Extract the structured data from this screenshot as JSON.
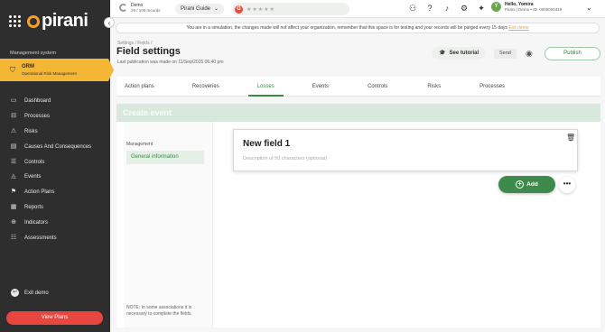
{
  "colors": {
    "brand": "#f4a12c",
    "module": "#f4b735",
    "accent": "#3b8a48",
    "danger": "#e9463f",
    "sidebar": "#2e2e2e"
  },
  "sidebar": {
    "logo": "pirani",
    "section_label": "Management system",
    "module": {
      "title": "ORM",
      "subtitle": "Operational Risk Management",
      "icon": "shield-icon"
    },
    "items": [
      {
        "label": "Dashboard",
        "icon": "monitor-icon"
      },
      {
        "label": "Processes",
        "icon": "processes-icon"
      },
      {
        "label": "Risks",
        "icon": "warning-icon"
      },
      {
        "label": "Causes And Consequences",
        "icon": "document-icon"
      },
      {
        "label": "Controls",
        "icon": "controls-icon"
      },
      {
        "label": "Events",
        "icon": "alert-icon"
      },
      {
        "label": "Action Plans",
        "icon": "flag-icon"
      },
      {
        "label": "Reports",
        "icon": "reports-icon"
      },
      {
        "label": "Indicators",
        "icon": "indicators-icon"
      },
      {
        "label": "Assessments",
        "icon": "assessments-icon"
      }
    ],
    "exit_label": "Exit demo",
    "view_plans_label": "View Plans"
  },
  "topbar": {
    "env_title": "Demo",
    "env_records": "29 / 100 records",
    "guide_label": "Pirani Guide",
    "user_greeting": "Hello, Yomira",
    "user_detail": "Pirani | Demo • ID: 0000000419",
    "avatar_initial": "Y"
  },
  "banner": {
    "text": "You are in a simulation, the changes made will not affect your organization, remember that this space is for testing and your records will be purged every 15 days",
    "link": "Exit demo"
  },
  "header": {
    "breadcrumb": "Settings / Fields /",
    "title": "Field settings",
    "last_publication": "Last publication was made on 11/Sep/2025 06:40 pm",
    "tutorial_label": "See tutorial",
    "send_label": "Send",
    "publish_label": "Publish"
  },
  "tabs": [
    {
      "label": "Action plans"
    },
    {
      "label": "Recoveries"
    },
    {
      "label": "Losses"
    },
    {
      "label": "Events"
    },
    {
      "label": "Controls"
    },
    {
      "label": "Risks"
    },
    {
      "label": "Processes"
    }
  ],
  "content": {
    "create_title": "Create event",
    "left_section": "Management",
    "left_item": "General information",
    "note": "NOTE: In some associations it is necessary to complete the fields.",
    "field_title": "New field 1",
    "field_description_placeholder": "Description of 50 characters (optional)",
    "add_label": "Add",
    "more_label": "•••"
  }
}
